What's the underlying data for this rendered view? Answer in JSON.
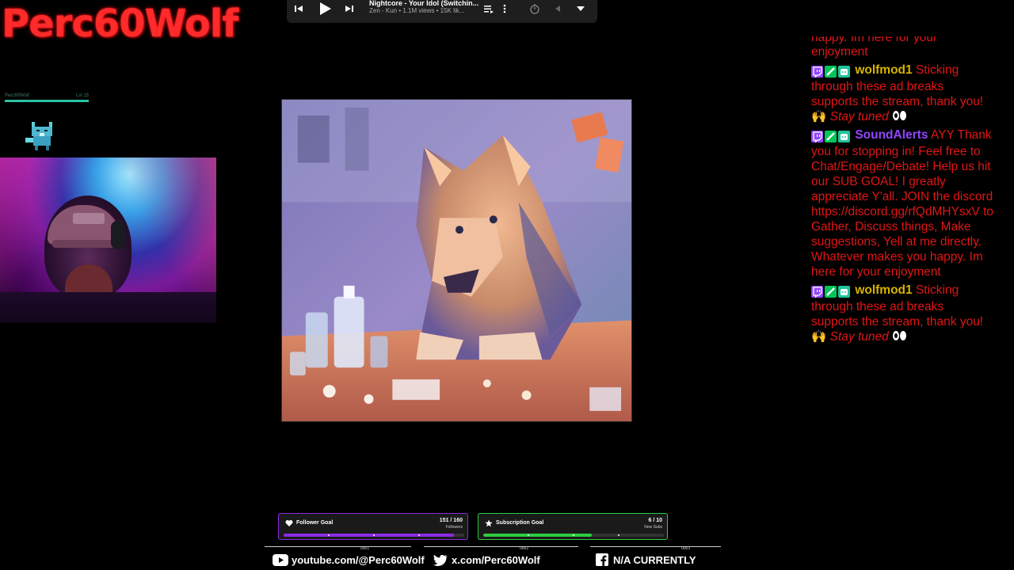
{
  "logo": {
    "text": "Perc60Wolf"
  },
  "mini_status": {
    "name": "Perc60Wolf",
    "level": "Lvl 15",
    "fill_fraction": 1.0
  },
  "youtube_player": {
    "title": "Nightcore - Your Idol (Switchin...",
    "subtitle": "Zen - Kun • 1.1M views • 15K lik...",
    "icons": [
      "previous-icon",
      "play-icon",
      "next-icon",
      "queue-icon",
      "more-icon",
      "timer-icon",
      "collapse-left-icon",
      "chevron-down-icon"
    ]
  },
  "chat": {
    "top_cut_text": "happy. Im here for your",
    "top_cut_end": "enjoyment",
    "messages": [
      {
        "user": "wolfmod1",
        "user_color": "#d6b400",
        "text": "Sticking through these ad breaks supports the stream, thank you! 🙌",
        "tail": "Stay tuned"
      },
      {
        "user": "SoundAlerts",
        "user_color": "#9146ff",
        "text": "AYY Thank you for stopping in! Feel free to Chat/Engage/Debate! Help us hit our SUB GOAL! I greatly appreciate Y'all. JOIN the discord https://discord.gg/rfQdMHYsxV to Gather, Discuss things, Make suggestions, Yell at me directly. Whatever makes you happy. Im here for your enjoyment",
        "tail": ""
      },
      {
        "user": "wolfmod1",
        "user_color": "#d6b400",
        "text": "Sticking through these ad breaks supports the stream, thank you! 🙌",
        "tail": "Stay tuned"
      }
    ]
  },
  "goals": [
    {
      "title": "Follower Goal",
      "value": "151 / 160",
      "unit": "Followers",
      "current": 151,
      "target": 160,
      "color": "#8a2be2",
      "border": "#8a2be2"
    },
    {
      "title": "Subscription Goal",
      "value": "6 / 10",
      "unit": "New Subs",
      "current": 6,
      "target": 10,
      "color": "#2ecc40",
      "border": "#2ecc40"
    }
  ],
  "dividers": {
    "t1": "0001",
    "t2": "0002",
    "t3": "0003"
  },
  "socials": [
    {
      "icon": "youtube-icon",
      "label": "youtube.com/@Perc60Wolf"
    },
    {
      "icon": "twitter-icon",
      "label": "x.com/Perc60Wolf"
    },
    {
      "icon": "facebook-icon",
      "label": "N/A CURRENTLY"
    }
  ]
}
